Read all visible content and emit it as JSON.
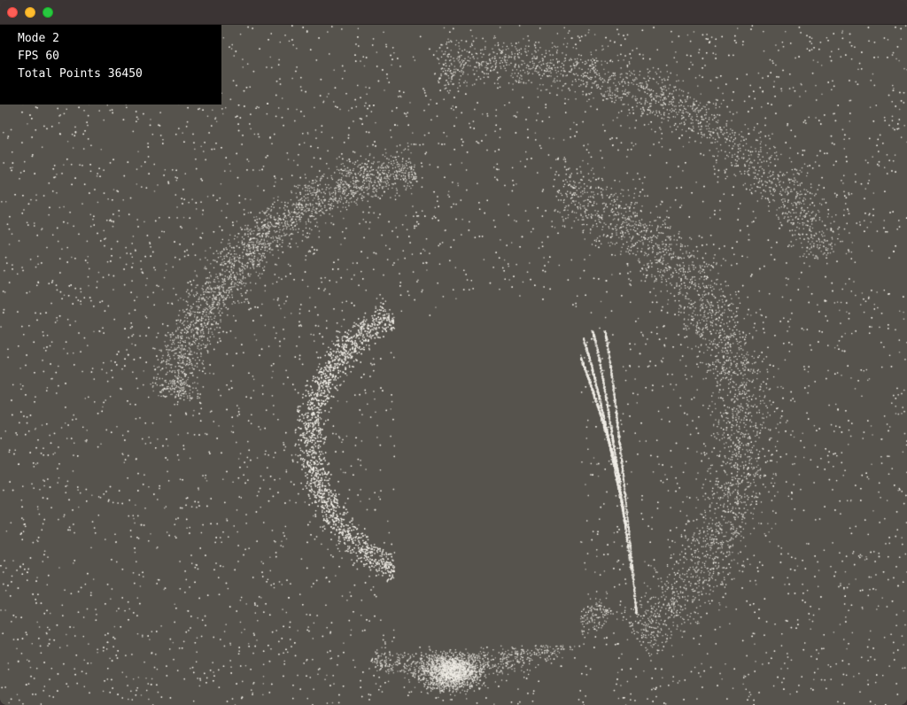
{
  "window": {
    "title": "",
    "controls": [
      "close",
      "minimize",
      "zoom"
    ]
  },
  "hud": {
    "mode_label": "Mode",
    "mode_value": "2",
    "fps_label": "FPS",
    "fps_value": "60",
    "points_label": "Total Points",
    "points_value": "36450"
  },
  "colors": {
    "background": "#56534d",
    "particle": "#f2efe8",
    "hud_background": "#000000",
    "hud_text": "#ffffff",
    "titlebar": "#3b3434"
  }
}
